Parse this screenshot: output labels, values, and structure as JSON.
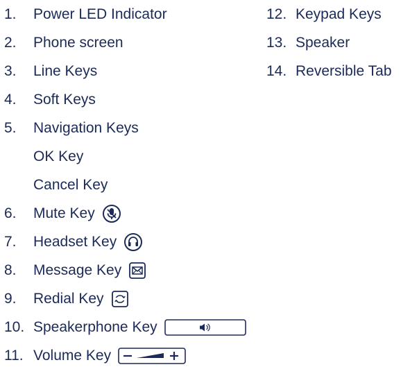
{
  "left_column": [
    {
      "num": "1.",
      "label": "Power LED Indicator"
    },
    {
      "num": "2.",
      "label": "Phone screen"
    },
    {
      "num": "3.",
      "label": "Line Keys"
    },
    {
      "num": "4.",
      "label": "Soft Keys"
    },
    {
      "num": "5.",
      "label": "Navigation Keys"
    },
    {
      "num": "",
      "label": "OK Key"
    },
    {
      "num": "",
      "label": "Cancel Key"
    },
    {
      "num": "6.",
      "label": "Mute Key",
      "icon": "mute-microphone-icon"
    },
    {
      "num": "7.",
      "label": "Headset Key",
      "icon": "headset-icon"
    },
    {
      "num": "8.",
      "label": "Message Key",
      "icon": "envelope-icon"
    },
    {
      "num": "9.",
      "label": "Redial Key",
      "icon": "redial-icon"
    },
    {
      "num": "10.",
      "label": "Speakerphone Key",
      "icon": "speaker-icon"
    },
    {
      "num": "11.",
      "label": "Volume Key",
      "icon": "volume-icon"
    }
  ],
  "right_column": [
    {
      "num": "12.",
      "label": "Keypad Keys"
    },
    {
      "num": "13.",
      "label": "Speaker"
    },
    {
      "num": "14.",
      "label": "Reversible Tab"
    }
  ],
  "colors": {
    "text": "#1b2a57"
  }
}
